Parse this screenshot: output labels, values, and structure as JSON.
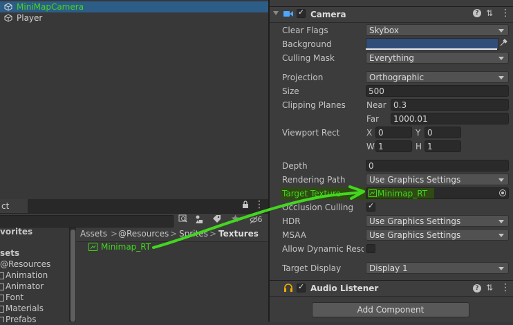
{
  "hierarchy": {
    "items": [
      {
        "label": "MiniMapCamera",
        "selected": true
      },
      {
        "label": "Player",
        "selected": false
      }
    ]
  },
  "project": {
    "tab_label": "ct",
    "count_badge": "6",
    "tree": [
      "vorites",
      "sets",
      "@Resources",
      "Animation",
      "Animator",
      "Font",
      "Materials",
      "Prefabs"
    ],
    "breadcrumb": [
      "Assets",
      ">",
      "@Resources",
      ">",
      "Sprites",
      ">",
      "Textures"
    ],
    "asset": "Minimap_RT"
  },
  "inspector": {
    "camera": {
      "title": "Camera",
      "clear_flags_label": "Clear Flags",
      "clear_flags_value": "Skybox",
      "background_label": "Background",
      "background_color": "#314d79",
      "culling_mask_label": "Culling Mask",
      "culling_mask_value": "Everything",
      "projection_label": "Projection",
      "projection_value": "Orthographic",
      "size_label": "Size",
      "size_value": "500",
      "clipping_label": "Clipping Planes",
      "near_label": "Near",
      "near_value": "0.3",
      "far_label": "Far",
      "far_value": "1000.01",
      "viewport_label": "Viewport Rect",
      "x_label": "X",
      "x_value": "0",
      "y_label": "Y",
      "y_value": "0",
      "w_label": "W",
      "w_value": "1",
      "h_label": "H",
      "h_value": "1",
      "depth_label": "Depth",
      "depth_value": "0",
      "rendering_path_label": "Rendering Path",
      "rendering_path_value": "Use Graphics Settings",
      "target_texture_label": "Target Texture",
      "target_texture_value": "Minimap_RT",
      "occlusion_label": "Occlusion Culling",
      "hdr_label": "HDR",
      "hdr_value": "Use Graphics Settings",
      "msaa_label": "MSAA",
      "msaa_value": "Use Graphics Settings",
      "dynamic_res_label": "Allow Dynamic Resol",
      "target_display_label": "Target Display",
      "target_display_value": "Display 1"
    },
    "audio_listener": {
      "title": "Audio Listener"
    },
    "add_component_label": "Add Component"
  },
  "colors": {
    "accent_green": "#43d61f",
    "selection": "#2c5d87"
  }
}
